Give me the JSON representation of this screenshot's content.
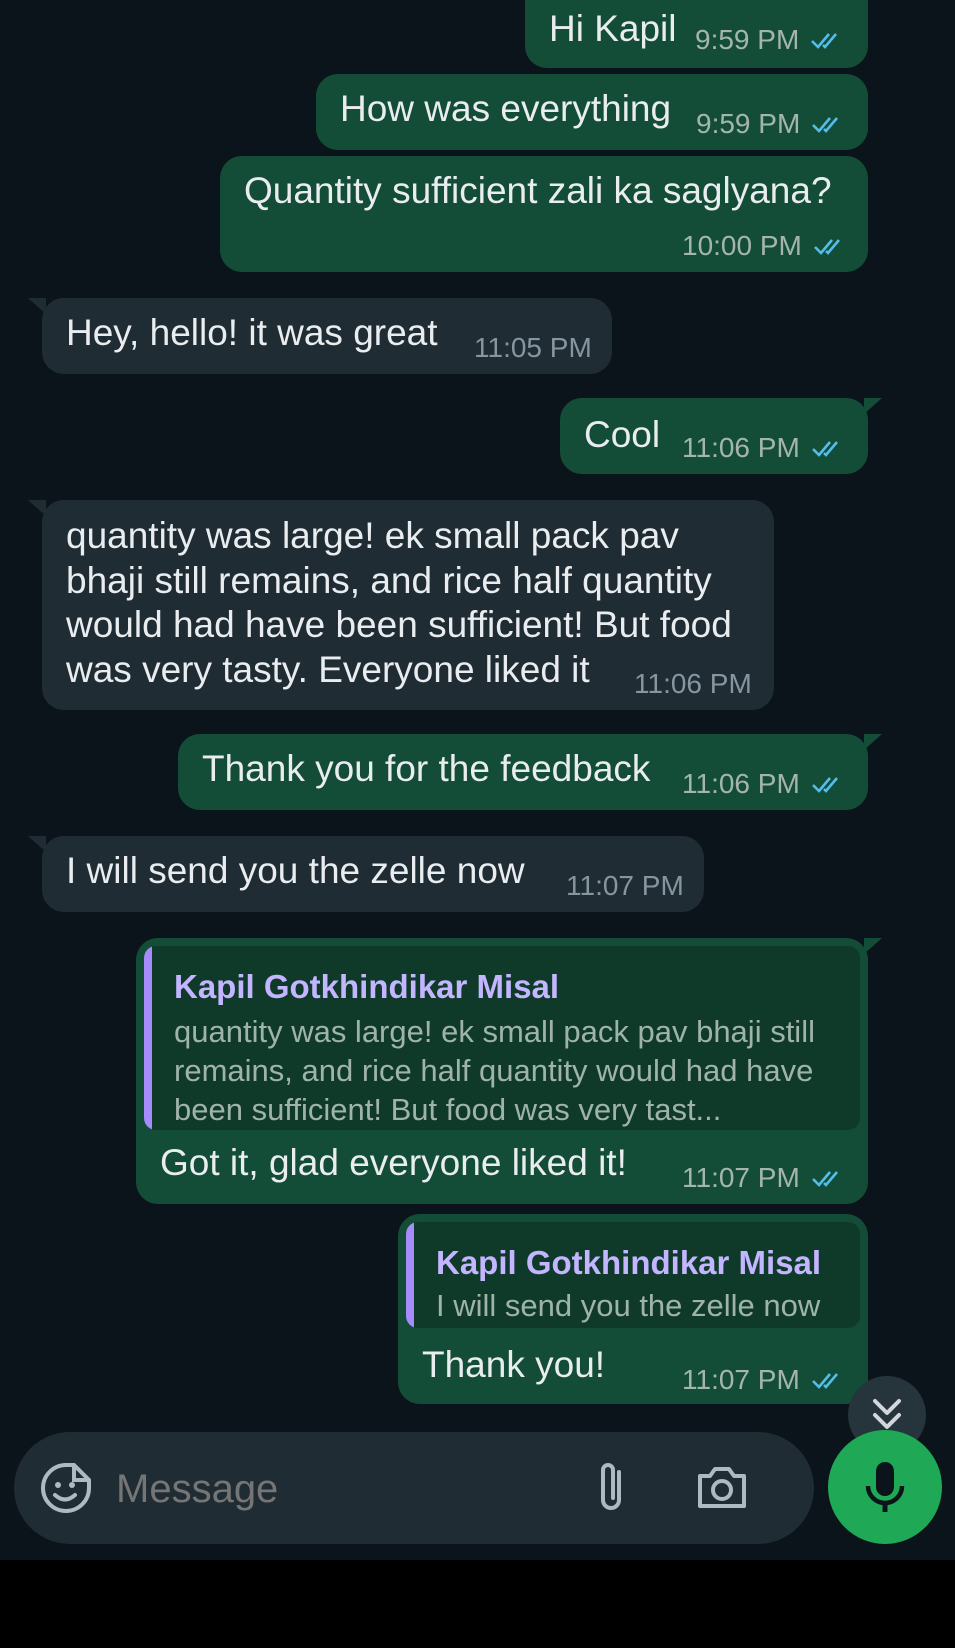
{
  "messages": [
    {
      "from": "me",
      "text": "Hi Kapil",
      "time": "9:59 PM"
    },
    {
      "from": "me",
      "text": "How was everything",
      "time": "9:59 PM"
    },
    {
      "from": "me",
      "text": "Quantity sufficient zali ka saglyana?",
      "time": "10:00 PM"
    },
    {
      "from": "them",
      "text": "Hey, hello! it was great",
      "time": "11:05 PM"
    },
    {
      "from": "me",
      "text": "Cool",
      "time": "11:06 PM"
    },
    {
      "from": "them",
      "text": "quantity was large! ek small pack pav bhaji still remains, and rice half quantity would had have been sufficient! But food was very tasty. Everyone liked it",
      "time": "11:06 PM"
    },
    {
      "from": "me",
      "text": "Thank you for the feedback",
      "time": "11:06 PM"
    },
    {
      "from": "them",
      "text": "I will send you the zelle now",
      "time": "11:07 PM"
    },
    {
      "from": "me",
      "text": "Got it, glad everyone liked it!",
      "time": "11:07 PM",
      "reply": {
        "name": "Kapil Gotkhindikar Misal",
        "text": "quantity was large! ek small pack pav bhaji still remains, and rice half quantity would had have been sufficient! But food was very tast..."
      }
    },
    {
      "from": "me",
      "text": "Thank you!",
      "time": "11:07 PM",
      "reply": {
        "name": "Kapil Gotkhindikar Misal",
        "text": "I will send you the zelle now"
      }
    }
  ],
  "input": {
    "placeholder": "Message"
  },
  "icons": {
    "emoji": "emoji-sticker-icon",
    "attach": "paperclip-icon",
    "camera": "camera-icon",
    "mic": "microphone-icon",
    "scroll": "double-chevron-down-icon",
    "read": "double-check-icon"
  },
  "colors": {
    "outgoing": "#144d37",
    "incoming": "#202c33",
    "background": "#0b141a",
    "accent": "#1fa855",
    "reply_name": "#c3b5ff",
    "read_ticks": "#53bdeb"
  }
}
